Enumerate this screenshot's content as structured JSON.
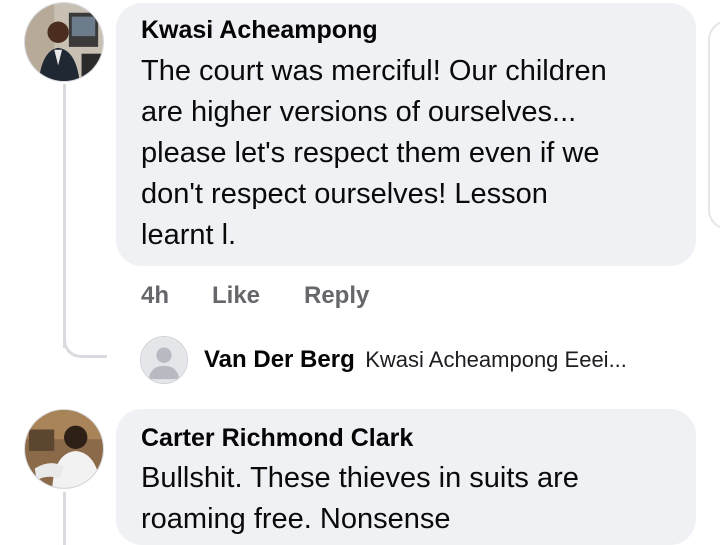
{
  "comments": [
    {
      "author": "Kwasi Acheampong",
      "lines": [
        "The court was merciful! Our children",
        "are higher versions of ourselves...",
        "please let's respect them even if we",
        "don't respect ourselves! Lesson",
        "learnt l."
      ],
      "time": "4h",
      "like_label": "Like",
      "reply_label": "Reply",
      "avatar_icon": "profile-photo-man-in-suit"
    },
    {
      "author": "Carter Richmond Clark",
      "lines": [
        "Bullshit. These thieves in suits are",
        "roaming free. Nonsense"
      ],
      "avatar_icon": "profile-photo-man-in-white"
    }
  ],
  "reply_preview": {
    "author": "Van Der Berg",
    "text": "Kwasi Acheampong Eeei...",
    "avatar_icon": "default-user-icon"
  },
  "colors": {
    "bubble": "#eff1f4",
    "meta_text": "#65676b",
    "thread_line": "#d9dbe0"
  }
}
